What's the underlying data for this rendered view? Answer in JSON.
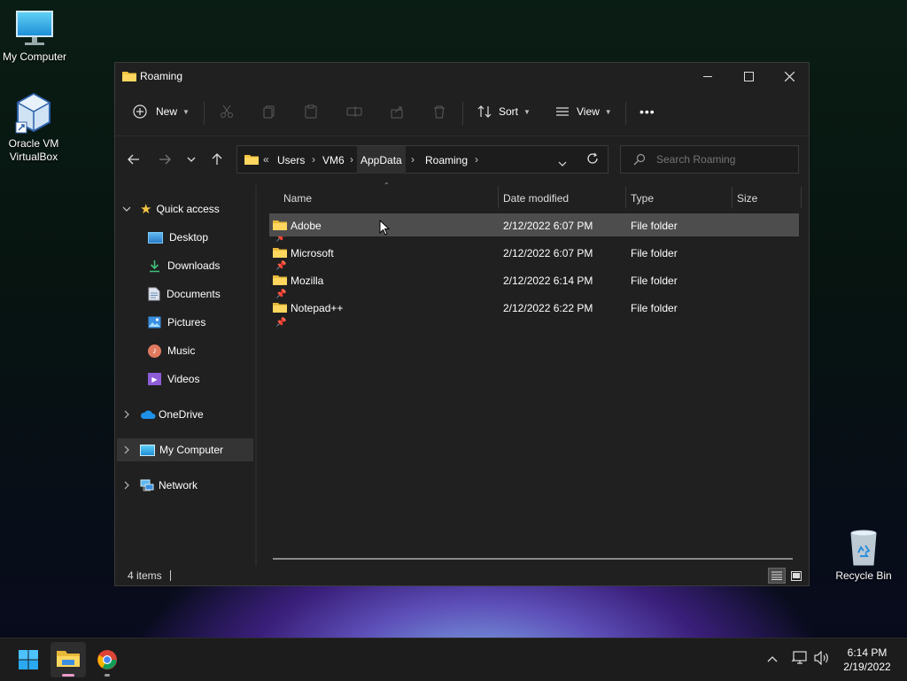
{
  "desktop": {
    "icons": [
      {
        "label": "My Computer"
      },
      {
        "label": "Oracle VM\nVirtualBox"
      },
      {
        "label": "Recycle Bin"
      }
    ]
  },
  "window": {
    "title": "Roaming",
    "toolbar": {
      "new_label": "New",
      "sort_label": "Sort",
      "view_label": "View",
      "more_label": "•••"
    },
    "address": {
      "overflow": "«",
      "crumbs": [
        "Users",
        "VM6",
        "AppData",
        "Roaming"
      ]
    },
    "search": {
      "placeholder": "Search Roaming"
    },
    "sidebar": {
      "quick_access": "Quick access",
      "items": [
        {
          "label": "Desktop"
        },
        {
          "label": "Downloads"
        },
        {
          "label": "Documents"
        },
        {
          "label": "Pictures"
        },
        {
          "label": "Music"
        },
        {
          "label": "Videos"
        }
      ],
      "onedrive": "OneDrive",
      "my_computer": "My Computer",
      "network": "Network"
    },
    "columns": {
      "name": "Name",
      "date": "Date modified",
      "type": "Type",
      "size": "Size"
    },
    "files": [
      {
        "name": "Adobe",
        "date": "2/12/2022 6:07 PM",
        "type": "File folder"
      },
      {
        "name": "Microsoft",
        "date": "2/12/2022 6:07 PM",
        "type": "File folder"
      },
      {
        "name": "Mozilla",
        "date": "2/12/2022 6:14 PM",
        "type": "File folder"
      },
      {
        "name": "Notepad++",
        "date": "2/12/2022 6:22 PM",
        "type": "File folder"
      }
    ],
    "status": {
      "count": "4 items"
    }
  },
  "taskbar": {
    "time": "6:14 PM",
    "date": "2/19/2022"
  },
  "colors": {
    "accent": "#4cc2ff",
    "folder": "#f4c542",
    "selected_row": "#4d4d4d"
  }
}
